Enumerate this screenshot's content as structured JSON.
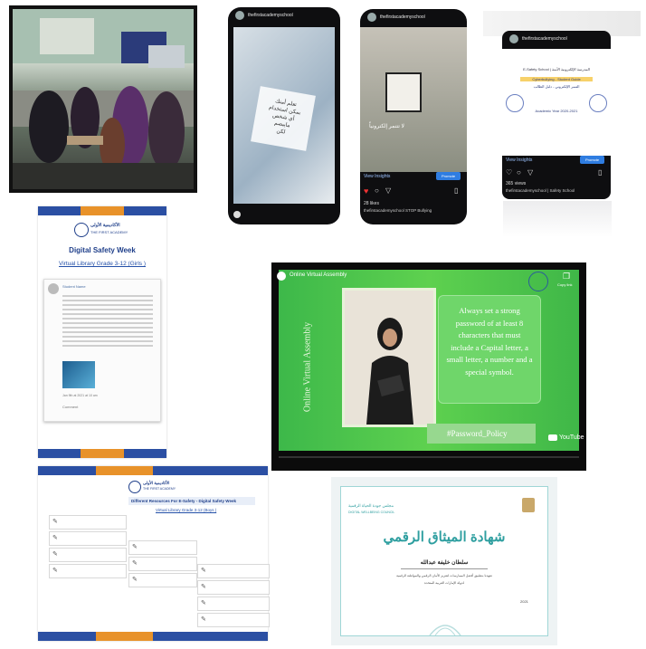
{
  "instagram": {
    "account": "thefirstacademyschool",
    "post1": {
      "overlay_lines": [
        "تعلم أمنك",
        "يمكن استخدام",
        "أي شخص",
        "مايبصم",
        "لكن"
      ]
    },
    "post2": {
      "view_insights": "View Insights",
      "promote": "Promote",
      "likes": "28 likes",
      "caption": "thefirstacademyschool STOP Bullying",
      "overlay": "لا تتنمر إلكترونياً"
    },
    "post3": {
      "view_insights": "View Insights",
      "promote": "Promote",
      "likes": "365 views",
      "caption": "thefirstacademyschool | Safety School",
      "doc_title": "E-Safety School | المدرسة الإلكترونية الآمنة",
      "doc_sub1": "Cyberbullying - Student Guide",
      "doc_sub2": "التنمر الإلكتروني - دليل الطالب",
      "doc_year": "Academic Year 2020-2021"
    }
  },
  "digital_safety": {
    "logo_ar": "الأكاديمية الأولى",
    "logo_en": "THE FIRST ACADEMY",
    "title": "Digital Safety Week",
    "subtitle": "Virtual Library Grade 3-12 (Girls )",
    "post_author": "Student Name",
    "post_footer": "Comment",
    "post_date": "Jan 9th at 2021 at 10 am"
  },
  "resources": {
    "logo_ar": "الأكاديمية الأولى",
    "logo_en": "THE FIRST ACADEMY",
    "title": "Different Resources For E-Safety - Digital Safety Week",
    "subtitle": "Virtual Library Grade 3-12 (Boys )"
  },
  "video": {
    "title": "Online Virtual Assembly",
    "copy_link": "Copy link",
    "side_text": "Online Virtual Assembly",
    "quote": "Always set a strong password of at least 8 characters that must include a Capital letter, a small letter, a number and a special symbol.",
    "hashtag": "#Password_Policy",
    "youtube": "YouTube"
  },
  "certificate": {
    "council_ar": "مجلس جودة الحياة الرقمية",
    "council_en": "DIGITAL WELLBEING COUNCIL",
    "title": "شهادة الميثاق الرقمي",
    "name": "سلطان خليفة عبدالله",
    "body_line1": "تعهدنا بتطبيق أفضل الممارسات لتعزيز الأمان الرقمي والمواطنة الرقمية",
    "body_line2": "لدولة الإمارات العربية المتحدة",
    "date": "2021"
  },
  "colors": {
    "stripe_blue": "#2b4fa3",
    "stripe_orange": "#e8922a",
    "video_green": "#4cc24b",
    "cert_teal": "#2f9fa0"
  }
}
